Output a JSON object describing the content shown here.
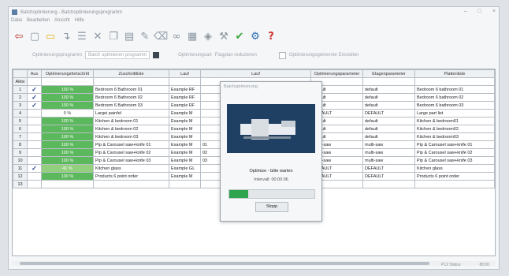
{
  "window": {
    "title": "Batchoptimierung - Batchoptimierungsprogramm",
    "minimize": "–",
    "maximize": "□",
    "close": "×"
  },
  "menu": [
    "Datei",
    "Bearbeiten",
    "Ansicht",
    "Hilfe"
  ],
  "toolbar": [
    "exit-icon",
    "new-icon",
    "open-icon",
    "import-icon",
    "list-icon",
    "delete-icon",
    "copy-icon",
    "paste-icon",
    "edit-icon",
    "eraser-icon",
    "link-icon",
    "database-icon",
    "optimize-icon",
    "tools-icon",
    "checkmark-icon",
    "settings-icon",
    "help-icon"
  ],
  "filterbar": {
    "label1": "Optimierungsprogramm",
    "value1": "Batch optimieren programm",
    "label2": "Optimierungsart",
    "value2": "Flagplan reduzieren",
    "check_label": "Optimierungsgetrennte Einstellen"
  },
  "table": {
    "columns": [
      "",
      "Aus",
      "Optimierungsfortschritt",
      "Zuschnittliste",
      "Lauf",
      "Lauf",
      "Optimierungsparameter",
      "Etagenparameter",
      "Plattenliste"
    ],
    "header_row_label": "Aktiv",
    "rows": [
      {
        "n": "1",
        "check": "✓",
        "progress": "100 %",
        "list": "Bedroom 6 Bathroom 01",
        "run1": "Example RF",
        "run2": "",
        "param": "default",
        "stage": "default",
        "plate": "Bedroom 6 bathroom 01",
        "status": "full"
      },
      {
        "n": "2",
        "check": "✓",
        "progress": "100 %",
        "list": "Bedroom 6 Bathroom 02",
        "run1": "Example RF",
        "run2": "",
        "param": "default",
        "stage": "default",
        "plate": "Bedroom 6 bathroom 02",
        "status": "full"
      },
      {
        "n": "3",
        "check": "✓",
        "progress": "100 %",
        "list": "Bedroom 6 Bathroom 03",
        "run1": "Example RF",
        "run2": "",
        "param": "default",
        "stage": "default",
        "plate": "Bedroom 6 bathroom 03",
        "status": "full"
      },
      {
        "n": "4",
        "check": "",
        "progress": "0 %",
        "list": "Largei painfel",
        "run1": "Example M",
        "run2": "",
        "param": "DEFAULT",
        "stage": "DEFAULT",
        "plate": "Large part list",
        "status": "low"
      },
      {
        "n": "5",
        "check": "",
        "progress": "100 %",
        "list": "Kitchen & bedroom 01",
        "run1": "Example M",
        "run2": "",
        "param": "default",
        "stage": "default",
        "plate": "Kitchen & bedroom01",
        "status": "full"
      },
      {
        "n": "6",
        "check": "",
        "progress": "100 %",
        "list": "Kitchen & bedroom 02",
        "run1": "Example M",
        "run2": "",
        "param": "default",
        "stage": "default",
        "plate": "Kitchen & bedroom02",
        "status": "full"
      },
      {
        "n": "7",
        "check": "",
        "progress": "100 %",
        "list": "Kitchen & bedroom 03",
        "run1": "Example M",
        "run2": "",
        "param": "default",
        "stage": "default",
        "plate": "Kitchen & bedroom03",
        "status": "full"
      },
      {
        "n": "8",
        "check": "",
        "progress": "100 %",
        "list": "Pip & Carousel saw+knife 01",
        "run1": "Example M",
        "run2": "01",
        "param": "multi-saw",
        "stage": "multi-saw",
        "plate": "Pip & Carousel saw+knife 01",
        "status": "full"
      },
      {
        "n": "9",
        "check": "",
        "progress": "100 %",
        "list": "Pip & Carousel saw+knife 02",
        "run1": "Example M",
        "run2": "02",
        "param": "multi-saw",
        "stage": "multi-saw",
        "plate": "Pip & Carousel saw+knife 02",
        "status": "full"
      },
      {
        "n": "10",
        "check": "",
        "progress": "100 %",
        "list": "Pip & Carousel saw+knife 03",
        "run1": "Example M",
        "run2": "03",
        "param": "multi-saw",
        "stage": "multi-saw",
        "plate": "Pip & Carousel saw+knife 03",
        "status": "full"
      },
      {
        "n": "11",
        "check": "✓",
        "progress": "41 %",
        "list": "Kitchen glass",
        "run1": "Example GL",
        "run2": "",
        "param": "DEFAULT",
        "stage": "DEFAULT",
        "plate": "Kitchen glass",
        "status": "partial"
      },
      {
        "n": "12",
        "check": "",
        "progress": "100 %",
        "list": "Products 6 point order",
        "run1": "Example M",
        "run2": "",
        "param": "DEFAULT",
        "stage": "DEFAULT",
        "plate": "Products 6 point order",
        "status": "full"
      },
      {
        "n": "13",
        "check": "",
        "progress": "",
        "list": "",
        "run1": "",
        "run2": "",
        "param": "",
        "stage": "",
        "plate": "",
        "status": "empty"
      }
    ]
  },
  "dialog": {
    "title": "Batchoptimierung",
    "message": "Optimize - bitte warten",
    "sub": "Intervall: 00:00:06",
    "progress": 0.22,
    "stop_label": "Stopp"
  },
  "status": {
    "left": "P12 Status",
    "right": "80:00"
  },
  "colors": {
    "done": "#5cb85c",
    "partial": "#93d07e",
    "progress": "#2ea44f",
    "check": "#1d3f8f"
  }
}
